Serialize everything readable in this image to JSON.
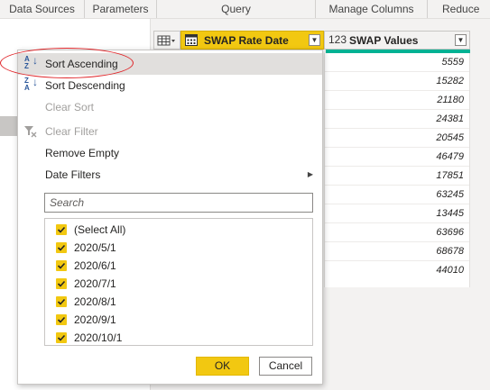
{
  "ribbon": {
    "groups": [
      "Data Sources",
      "Parameters",
      "Query",
      "Manage Columns",
      "Reduce Ro"
    ]
  },
  "columns": {
    "date": {
      "label": "SWAP Rate Date",
      "type_icon": "calendar-icon"
    },
    "values": {
      "label": "SWAP Values",
      "type_icon": "123"
    },
    "type_selector_icon": "table-icon"
  },
  "swap_values": [
    "5559",
    "15282",
    "21180",
    "24381",
    "20545",
    "46479",
    "17851",
    "63245",
    "13445",
    "63696",
    "68678",
    "44010"
  ],
  "menu": {
    "sort_ascending": "Sort Ascending",
    "sort_descending": "Sort Descending",
    "clear_sort": "Clear Sort",
    "clear_filter": "Clear Filter",
    "remove_empty": "Remove Empty",
    "date_filters": "Date Filters",
    "search_placeholder": "Search",
    "items": [
      "(Select All)",
      "2020/5/1",
      "2020/6/1",
      "2020/7/1",
      "2020/8/1",
      "2020/9/1",
      "2020/10/1"
    ],
    "ok": "OK",
    "cancel": "Cancel"
  },
  "colors": {
    "accent": "#f2c811",
    "quality_bar": "#00b294",
    "highlight_circle": "#e0262a"
  }
}
